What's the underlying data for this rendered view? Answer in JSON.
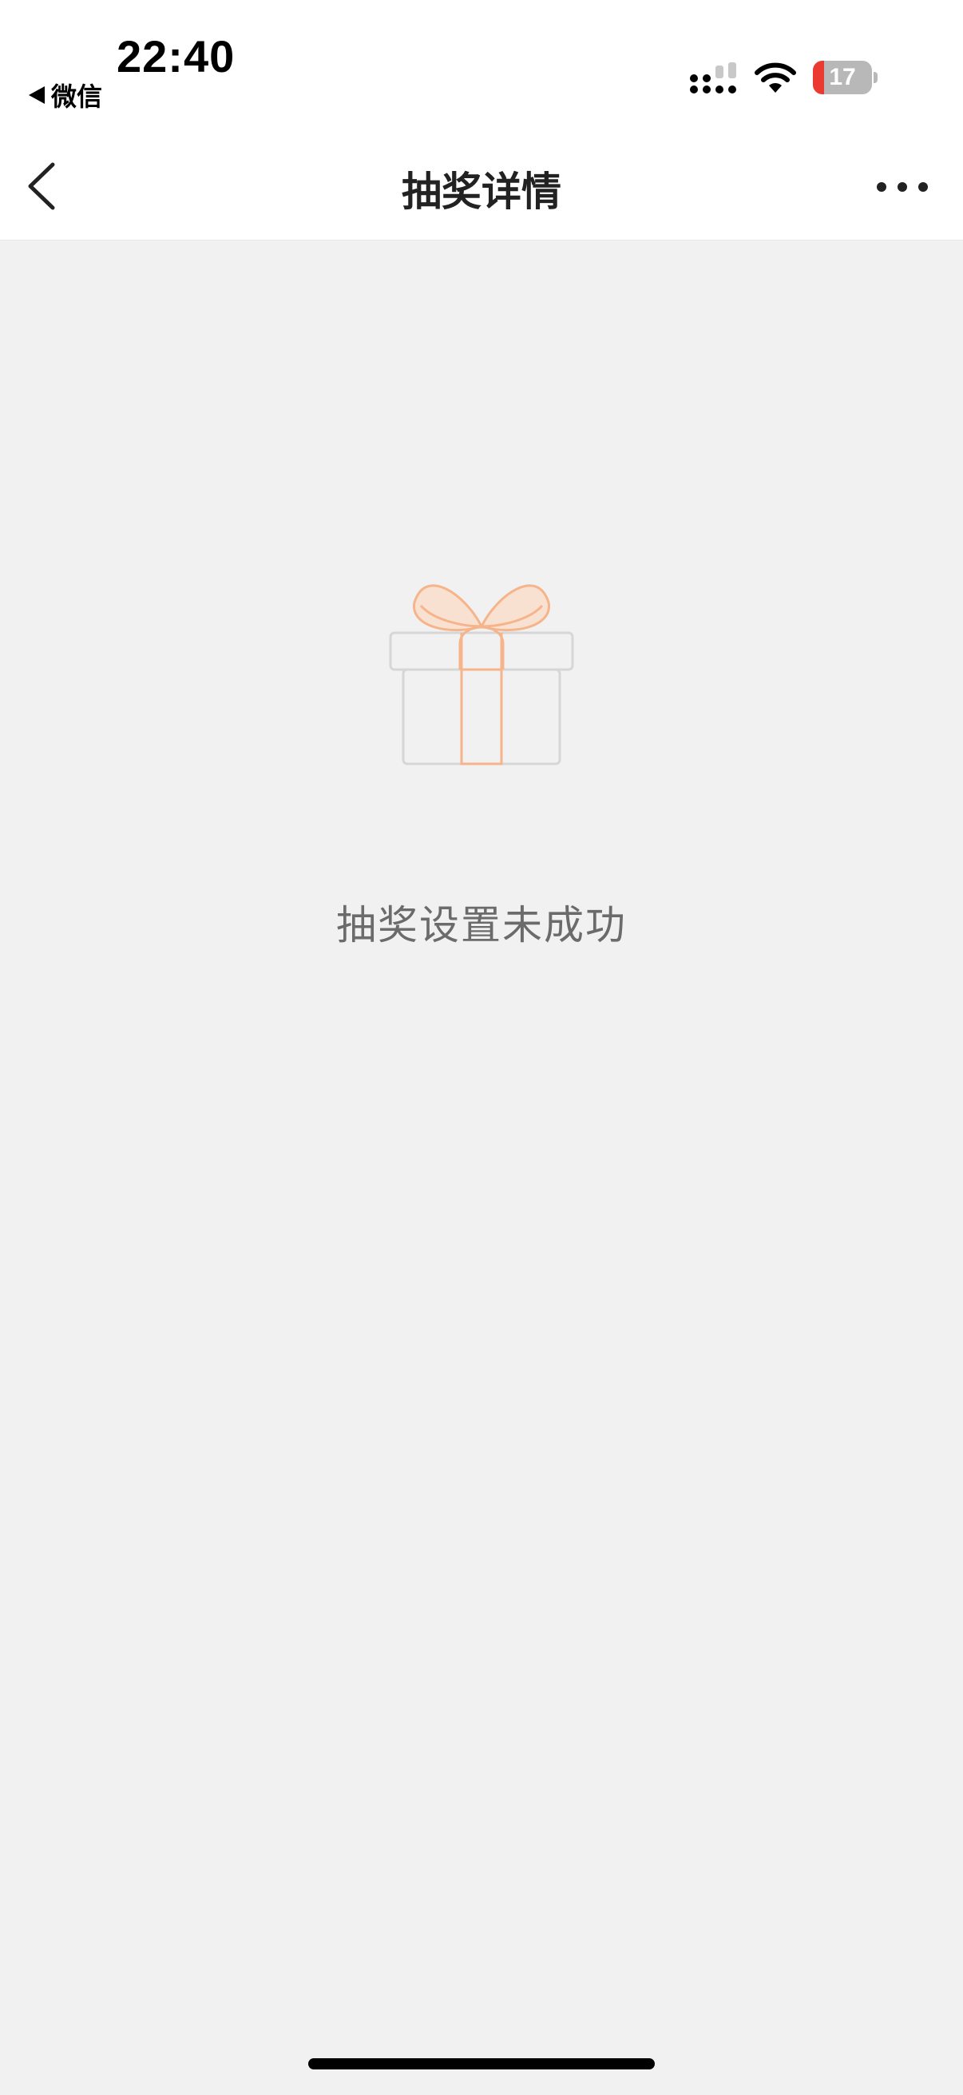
{
  "status_bar": {
    "time": "22:40",
    "back_app_label": "微信",
    "battery_level": "17"
  },
  "nav": {
    "title": "抽奖详情"
  },
  "empty_state": {
    "message": "抽奖设置未成功",
    "icon": "gift-icon"
  },
  "colors": {
    "background": "#f1f1f1",
    "header": "#ffffff",
    "gift_ribbon": "#f6b48a",
    "gift_box": "#d6d6d6",
    "battery_low": "#eb3b30"
  }
}
